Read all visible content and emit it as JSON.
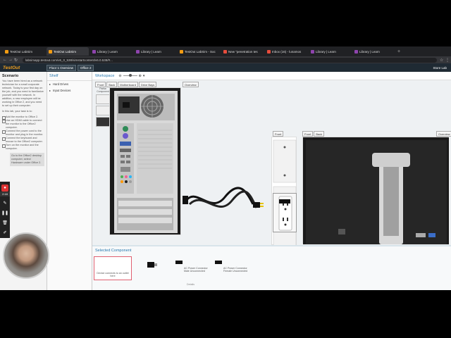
{
  "browser": {
    "tabs": [
      {
        "label": "TestOut LabSim",
        "color": "#f39c12"
      },
      {
        "label": "TestOut LabSim",
        "color": "#f39c12"
      },
      {
        "label": "Library | Learn",
        "color": "#8e44ad"
      },
      {
        "label": "Library | Learn",
        "color": "#8e44ad"
      },
      {
        "label": "TestOut LabSim - Soc",
        "color": "#f39c12"
      },
      {
        "label": "New \"penetration tes",
        "color": "#e74c3c"
      },
      {
        "label": "Inbox (16) - lunamos",
        "color": "#e74c3c"
      },
      {
        "label": "Library | Learn",
        "color": "#8e44ad"
      },
      {
        "label": "Library | Learn",
        "color": "#8e44ad"
      }
    ],
    "url": "labsimapp.testout.com/v6_0_538/simstartcontent/v6.0.538/#..."
  },
  "app": {
    "logo": "TestOut",
    "breadcrumb_1": "Floor 1 Overview",
    "breadcrumb_2": "Office 2",
    "store_lab": "Store Lab"
  },
  "scenario": {
    "title": "Scenario",
    "text": "You have been hired as a network technician for a small corporate network. Today is your first day on the job, and you need to familiarize yourself with the network. In addition, a new employee will be working in Office 2, and you need to set up their computer.",
    "task_intro": "In this lab, your task is to:",
    "tasks": [
      "Add the monitor to Office 2.",
      "Use an HDMI cable to connect the monitor to the Office2 computer.",
      "Connect the power cord to the monitor and plug in the monitor.",
      "Connect the keyboard and mouse to the Office2 computer.",
      "Turn on the monitor and the computer."
    ],
    "hint": "Go to the Office2 desktop computer, select Hardware under Office 2."
  },
  "recorder": {
    "time": "2:18"
  },
  "shelf": {
    "title": "Shelf",
    "items": [
      "Hard Drives",
      "Input Devices"
    ]
  },
  "workspace": {
    "title": "Workspace",
    "view_buttons": [
      "Front",
      "Back",
      "Motherboard",
      "Drive Bays"
    ],
    "overview_label": "Overview",
    "wall_button": "Front",
    "monitor_buttons": [
      "Front",
      "Back"
    ],
    "monitor_overview": "Overview",
    "partial_comp": "Partial Component"
  },
  "selected": {
    "title": "Selected Component",
    "cards": [
      {
        "label": "Device connects to an outlet here"
      },
      {
        "label": ""
      },
      {
        "label": "AC Power Connector Male Unconnected"
      },
      {
        "label": "AC Power Connector Female Unconnected"
      }
    ],
    "details": "Details"
  }
}
